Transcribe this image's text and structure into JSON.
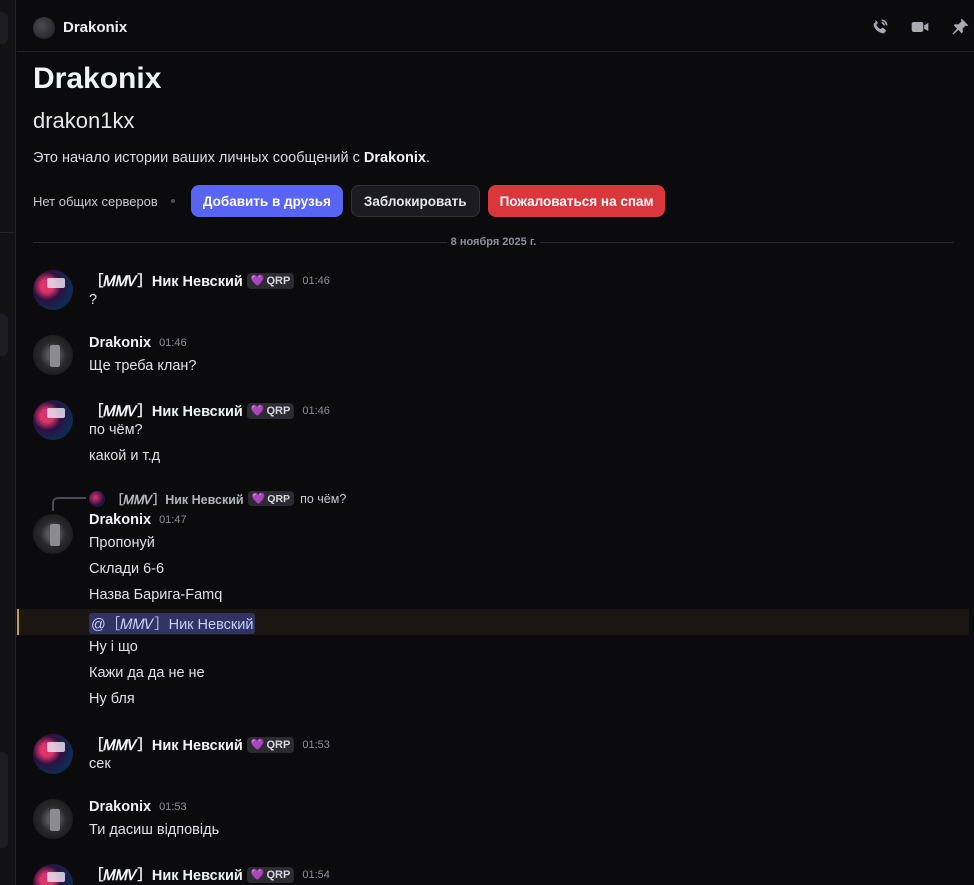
{
  "header": {
    "title": "Drakonix",
    "icons": [
      "phone-call-icon",
      "video-icon",
      "pin-icon"
    ]
  },
  "intro": {
    "display_name": "Drakonix",
    "username": "drakon1kx",
    "description_prefix": "Это начало истории ваших личных сообщений с ",
    "description_name": "Drakonix",
    "description_suffix": ".",
    "no_servers": "Нет общих серверов",
    "add_friend_label": "Добавить в друзья",
    "block_label": "Заблокировать",
    "report_label": "Пожаловаться на спам"
  },
  "date_divider": "8 ноября 2025 г.",
  "users": {
    "nick": {
      "name": "［𝑀𝑀𝑉］Ник Невский",
      "tag": "QRP"
    },
    "drak": {
      "name": "Drakonix"
    }
  },
  "messages": [
    {
      "author": "［𝑀𝑀𝑉］Ник Невский",
      "tag": "QRP",
      "time": "01:46",
      "lines": [
        "?"
      ]
    },
    {
      "author": "Drakonix",
      "time": "01:46",
      "lines": [
        "Ще треба клан?"
      ]
    },
    {
      "author": "［𝑀𝑀𝑉］Ник Невский",
      "tag": "QRP",
      "time": "01:46",
      "lines": [
        "по чём?",
        "какой и т.д"
      ]
    },
    {
      "author": "Drakonix",
      "time": "01:47",
      "reply": {
        "author": "［𝑀𝑀𝑉］Ник Невский",
        "tag": "QRP",
        "text": "по чём?"
      },
      "lines": [
        "Пропонуй",
        "Склади 6-6",
        "Назва Барига-Famq",
        "@［𝑀𝑀𝑉］Ник Невский",
        "Ну і що",
        "Кажи да да не не",
        "Ну бля"
      ]
    },
    {
      "author": "［𝑀𝑀𝑉］Ник Невский",
      "tag": "QRP",
      "time": "01:53",
      "lines": [
        "сек"
      ]
    },
    {
      "author": "Drakonix",
      "time": "01:53",
      "lines": [
        "Ти дасиш відповідь"
      ]
    },
    {
      "author": "［𝑀𝑀𝑉］Ник Невский",
      "tag": "QRP",
      "time": "01:54",
      "lines": []
    }
  ],
  "colors": {
    "background": "#0b0b0e",
    "blurple": "#5865f2",
    "danger": "#da373c",
    "mention_bg": "#303463",
    "highlight_border": "#c89b3c"
  }
}
